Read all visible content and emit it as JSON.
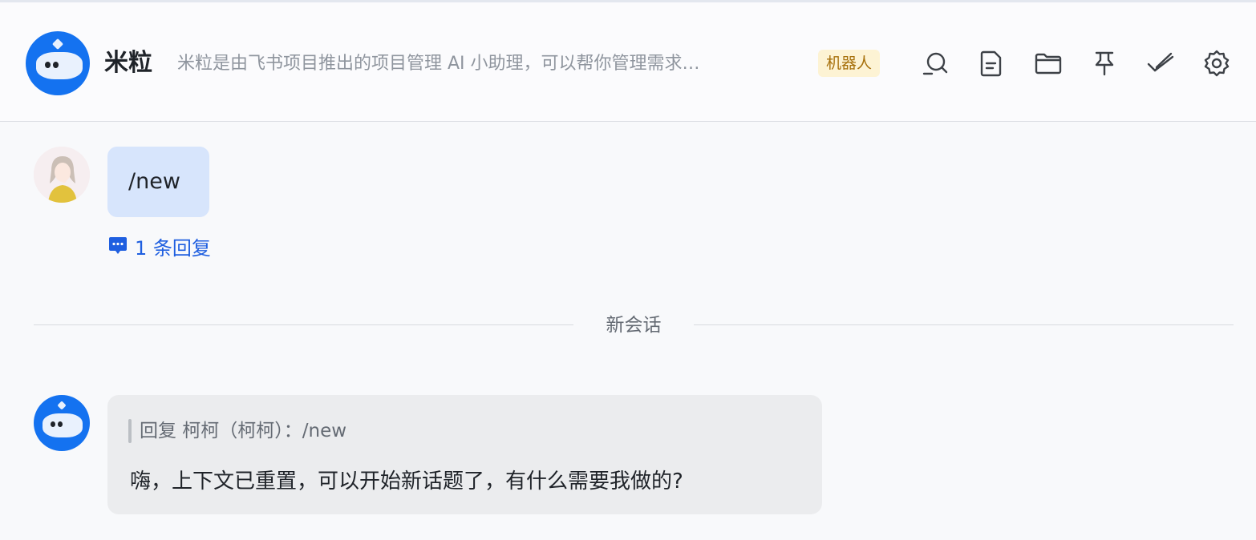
{
  "header": {
    "title": "米粒",
    "description": "米粒是由飞书项目推出的项目管理 AI 小助理，可以帮你管理需求…",
    "badge": "机器人",
    "toolbar": [
      {
        "icon": "search-icon"
      },
      {
        "icon": "document-icon"
      },
      {
        "icon": "folder-icon"
      },
      {
        "icon": "pin-icon"
      },
      {
        "icon": "check-icon"
      },
      {
        "icon": "gear-icon"
      }
    ]
  },
  "messages": {
    "user_message": {
      "text": "/new",
      "reply_count_label": "1 条回复"
    },
    "divider_label": "新会话",
    "bot_message": {
      "quote": "回复 柯柯（柯柯）：/new",
      "text": "嗨，上下文已重置，可以开始新话题了，有什么需要我做的?"
    }
  },
  "colors": {
    "accent": "#1472f0",
    "link": "#1f5fe0",
    "user_bubble": "#d7e5fc",
    "bot_bubble": "#ebecee",
    "badge_bg": "#fdf3d4",
    "badge_text": "#a7700b"
  }
}
